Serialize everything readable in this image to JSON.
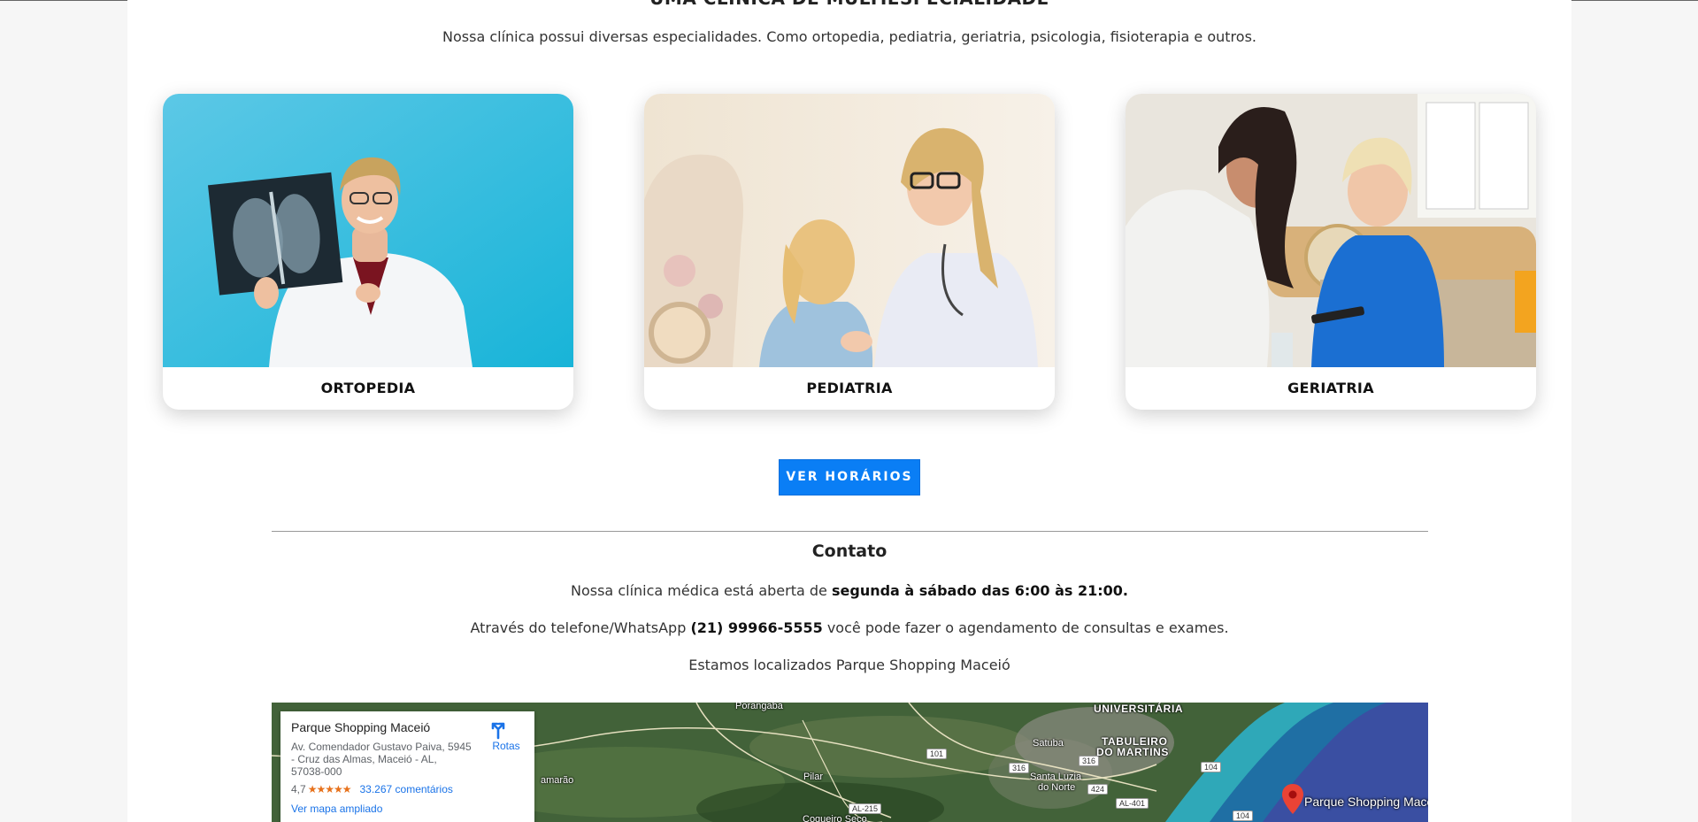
{
  "section": {
    "title_cut": "UMA CLÍNICA DE MULTIESPECIALIDADE",
    "intro": "Nossa clínica possui diversas especialidades. Como ortopedia, pediatria, geriatria, psicologia, fisioterapia e outros."
  },
  "specialties": [
    {
      "label": "ORTOPEDIA"
    },
    {
      "label": "PEDIATRIA"
    },
    {
      "label": "GERIATRIA"
    }
  ],
  "cta": {
    "label": "VER HORÁRIOS"
  },
  "contact": {
    "title": "Contato",
    "hours_prefix": "Nossa clínica médica está aberta de ",
    "hours_bold": "segunda à sábado das 6:00 às 21:00.",
    "phone_prefix": "Através do telefone/WhatsApp ",
    "phone_bold": "(21) 99966-5555",
    "phone_suffix": " você pode fazer o agendamento de consultas e exames.",
    "location": "Estamos localizados Parque Shopping Maceió"
  },
  "map": {
    "place_name": "Parque Shopping Maceió",
    "address": "Av. Comendador Gustavo Paiva, 5945 - Cruz das Almas, Maceió - AL, 57038-000",
    "rating": "4,7",
    "stars": "★★★★★",
    "reviews": "33.267 comentários",
    "enlarge_link": "Ver mapa ampliado",
    "directions_label": "Rotas",
    "pin_label": "Parque Shopping Maceió",
    "places": {
      "porangaba": "Porangaba",
      "universitaria": "UNIVERSITÁRIA",
      "tabuleiro": "TABULEIRO",
      "do_martins": "DO MARTINS",
      "satuba": "Satuba",
      "pilar": "Pilar",
      "santa_luzia": "Santa Luzia",
      "do_norte": "do Norte",
      "amarao": "amarão",
      "coqueiro": "Coqueiro Seco"
    },
    "roads": [
      "101",
      "316",
      "316",
      "424",
      "104",
      "104",
      "AL-215",
      "AL-401"
    ]
  },
  "colors": {
    "button": "#0a7ef5",
    "link": "#1a73e8",
    "pin": "#ea4335",
    "ortopedia_bg": "#2fb8dc"
  }
}
